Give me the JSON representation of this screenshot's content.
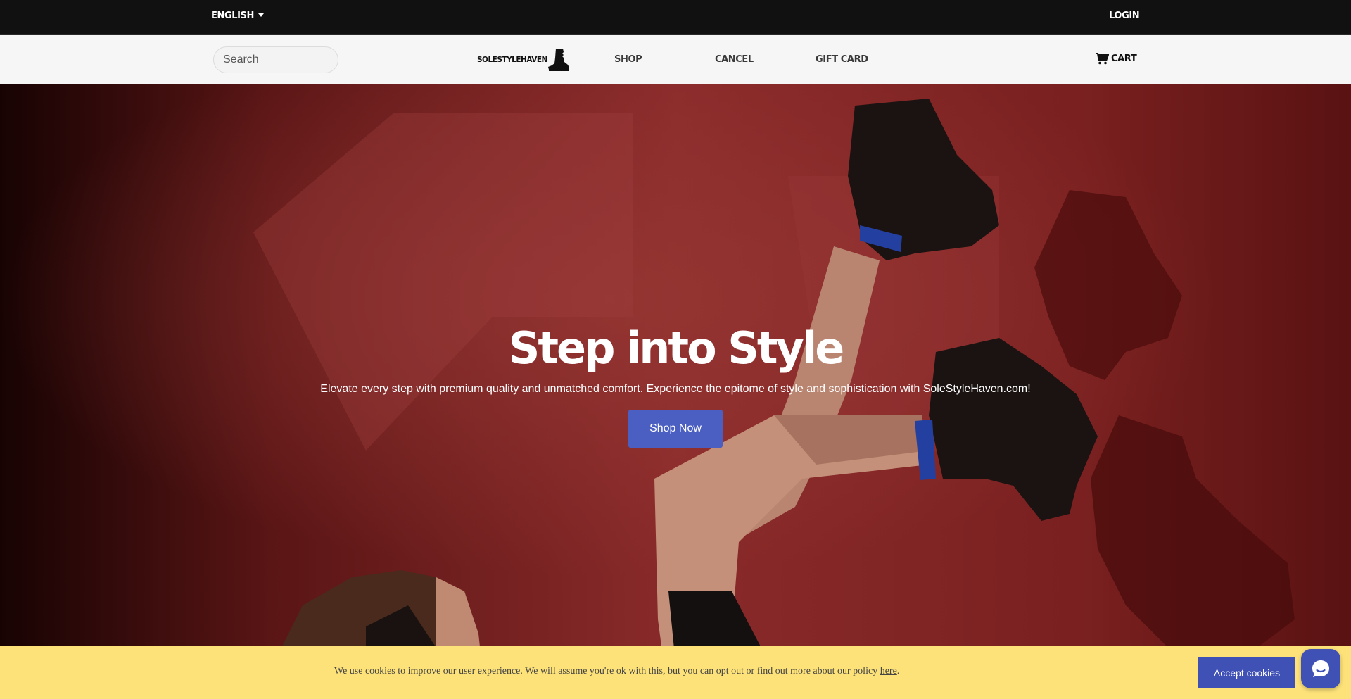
{
  "topbar": {
    "language_label": "ENGLISH",
    "login_label": "LOGIN"
  },
  "nav": {
    "search_placeholder": "Search",
    "logo_text": "SOLESTYLEHAVEN",
    "links": [
      "SHOP",
      "CANCEL",
      "GIFT CARD"
    ],
    "cart_label": "CART"
  },
  "hero": {
    "title": "Step into Style",
    "subtitle": "Elevate every step with premium quality and unmatched comfort. Experience the epitome of style and sophistication with SoleStyleHaven.com!",
    "cta_label": "Shop Now"
  },
  "cookie_banner": {
    "text": "We use cookies to improve our user experience. We will assume you're ok with this, but you can opt out or find out more about our policy",
    "link_label": "here",
    "trailing": ".",
    "accept_label": "Accept cookies"
  },
  "icons": {
    "caret": "chevron-down-icon",
    "logo_boot": "boot-icon",
    "cart": "cart-icon",
    "chat": "chat-icon"
  },
  "colors": {
    "topbar_bg": "#111111",
    "navbar_bg": "#f6f6f6",
    "hero_bg": "#7a2424",
    "cta_bg": "#4a5fc1",
    "cookie_bg": "#fde27a",
    "accept_bg": "#3f51b5"
  }
}
